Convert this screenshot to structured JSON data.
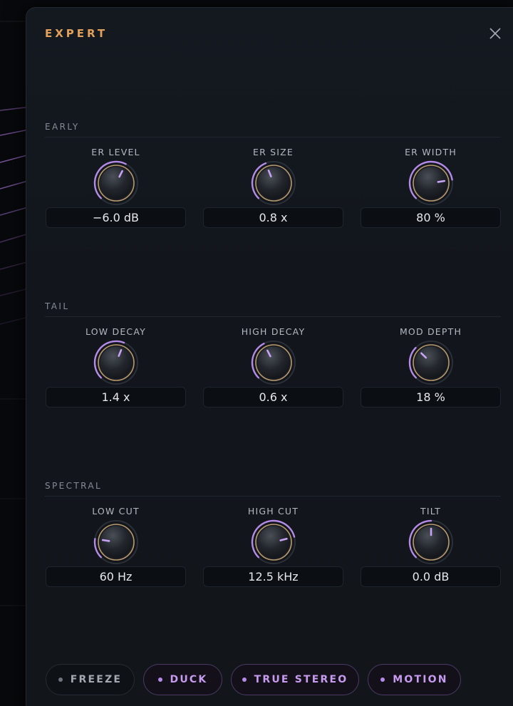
{
  "panel": {
    "title": "EXPERT",
    "accent_color": "#e2a05a",
    "knob_arc_color": "#b58be8",
    "close_icon": "close-icon"
  },
  "sections": [
    {
      "label": "EARLY",
      "knobs": [
        {
          "label": "ER LEVEL",
          "value": "−6.0 dB",
          "level": 0.6
        },
        {
          "label": "ER SIZE",
          "value": "0.8 x",
          "level": 0.42
        },
        {
          "label": "ER WIDTH",
          "value": "80 %",
          "level": 0.8
        }
      ]
    },
    {
      "label": "TAIL",
      "knobs": [
        {
          "label": "LOW DECAY",
          "value": "1.4 x",
          "level": 0.58
        },
        {
          "label": "HIGH DECAY",
          "value": "0.6 x",
          "level": 0.4
        },
        {
          "label": "MOD DEPTH",
          "value": "18 %",
          "level": 0.33
        }
      ]
    },
    {
      "label": "SPECTRAL",
      "knobs": [
        {
          "label": "LOW CUT",
          "value": "60 Hz",
          "level": 0.2
        },
        {
          "label": "HIGH CUT",
          "value": "12.5 kHz",
          "level": 0.78
        },
        {
          "label": "TILT",
          "value": "0.0 dB",
          "level": 0.5
        }
      ]
    }
  ],
  "toggles": [
    {
      "label": "FREEZE",
      "active": false
    },
    {
      "label": "DUCK",
      "active": true
    },
    {
      "label": "TRUE STEREO",
      "active": true
    },
    {
      "label": "MOTION",
      "active": true
    }
  ]
}
